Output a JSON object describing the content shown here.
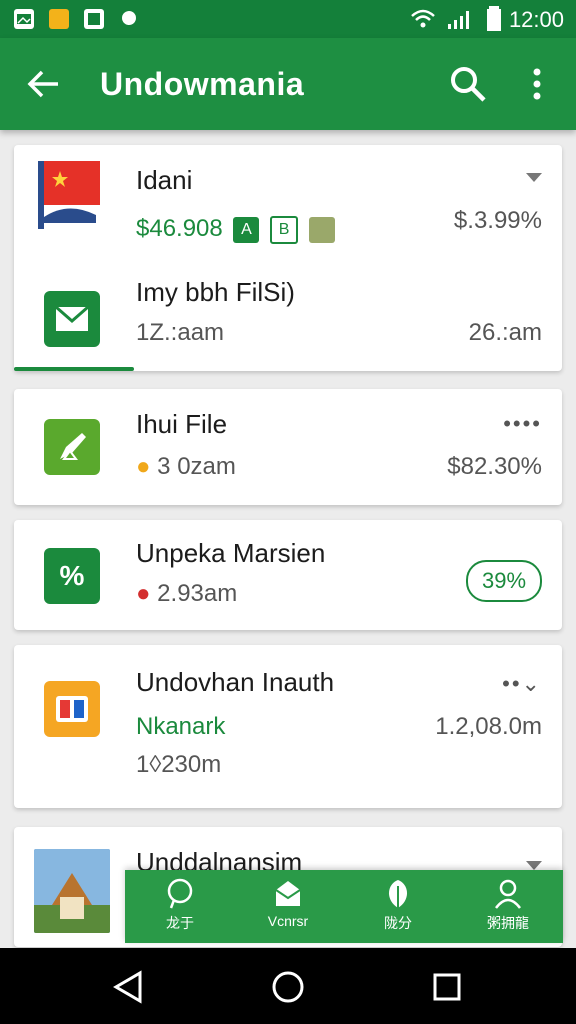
{
  "status_bar": {
    "time": "12:00"
  },
  "app_bar": {
    "title": "Undowmania"
  },
  "items": [
    {
      "title": "Idani",
      "price": "$46.908",
      "change": "$.3.99%",
      "badges": [
        "A",
        "B",
        ""
      ]
    },
    {
      "title": "Imy bbh FilSi)",
      "sub": "1Z.:aam",
      "right": "26.:am"
    },
    {
      "title": "Ihui File",
      "sub": "3 0zam",
      "right": "$82.30%"
    },
    {
      "title": "Unpeka Marsien",
      "sub": "2.93am",
      "pill": "39%"
    },
    {
      "title": "Undovhan Inauth",
      "line2": "Nkanark",
      "line2_right": "1.2,08.0m",
      "sub": "1◊230m"
    },
    {
      "title": "Unddalnansim"
    }
  ],
  "bottom_nav": [
    {
      "label": "龙于",
      "icon": "chat-icon"
    },
    {
      "label": "Vcnrsr",
      "icon": "mail-icon"
    },
    {
      "label": "陇分",
      "icon": "leaf-icon"
    },
    {
      "label": "粥拥龍",
      "icon": "profile-icon"
    }
  ],
  "colors": {
    "primary": "#1e8f42",
    "accent": "#1b8a3d",
    "status": "#14803a"
  }
}
